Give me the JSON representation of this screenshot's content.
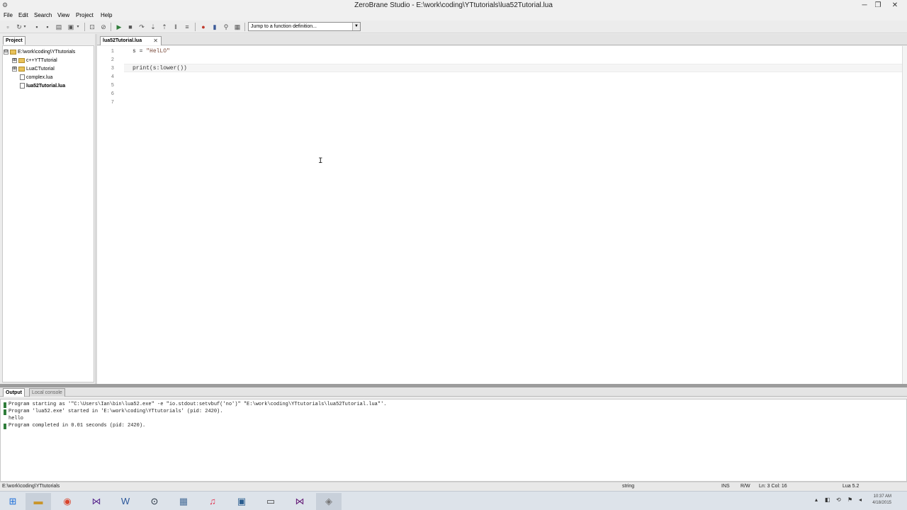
{
  "window": {
    "title": "ZeroBrane Studio - E:\\work\\coding\\YTtutorials\\lua52Tutorial.lua",
    "minimize": "─",
    "restore": "❐",
    "close": "✕"
  },
  "menu": [
    "File",
    "Edit",
    "Search",
    "View",
    "Project",
    "Help"
  ],
  "toolbar": {
    "function_jump_placeholder": "Jump to a function definition...",
    "function_jump_arrow": "▼",
    "icons": [
      "new-file-icon",
      "open-file-icon",
      "save-icon",
      "save-all-icon",
      "project-directory-icon",
      "find-icon",
      "find-in-files-icon",
      "run-icon",
      "stop-icon",
      "step-over-icon",
      "step-into-icon",
      "step-out-icon",
      "break-icon",
      "toggle-breakpoint-icon",
      "bookmark-icon",
      "watch-icon",
      "stack-icon"
    ]
  },
  "project": {
    "tab_label": "Project",
    "tree": [
      {
        "label": "E:\\work\\coding\\YTtutorials",
        "type": "root",
        "expander": "⊟"
      },
      {
        "label": "c++YTTutorial",
        "type": "folder",
        "expander": "⊞"
      },
      {
        "label": "LuaCTutorial",
        "type": "folder",
        "expander": "⊞"
      },
      {
        "label": "complex.lua",
        "type": "file"
      },
      {
        "label": "lua52Tutorial.lua",
        "type": "file",
        "active": true
      }
    ]
  },
  "editor": {
    "tab_label": "lua52Tutorial.lua",
    "tab_close": "✕",
    "line_numbers": [
      "1",
      "2",
      "3",
      "4",
      "5",
      "6",
      "7"
    ],
    "lines": {
      "l1_var": "s",
      "l1_op": " = ",
      "l1_str": "\"HelLO\"",
      "l3": "print(s:lower())"
    },
    "cursor_glyph": "I"
  },
  "bottom": {
    "tabs": [
      "Output",
      "Local console"
    ],
    "output_lines": [
      "Program starting as '\"C:\\Users\\Ian\\bin\\lua52.exe\" -e \"io.stdout:setvbuf('no')\" \"E:\\work\\coding\\YTtutorials\\lua52Tutorial.lua\"'.",
      "Program 'lua52.exe' started in 'E:\\work\\coding\\YTtutorials' (pid: 2420).",
      "hello",
      "Program completed in 0.01 seconds (pid: 2420)."
    ]
  },
  "status": {
    "path": "E:\\work\\coding\\YTtutorials",
    "token_type": "string",
    "insert_mode": "INS",
    "rw": "R/W",
    "position": "Ln: 3 Col: 16",
    "interpreter": "Lua 5.2"
  },
  "taskbar": {
    "apps": [
      "windows-start-icon",
      "file-explorer-icon",
      "chrome-icon",
      "visual-studio-icon",
      "word-icon",
      "steam-icon",
      "calculator-icon",
      "itunes-icon",
      "remote-desktop-icon",
      "media-app-icon",
      "visual-studio-2-icon",
      "zerobrane-icon"
    ],
    "clock_time": "10:37 AM",
    "clock_date": "4/18/2015"
  }
}
